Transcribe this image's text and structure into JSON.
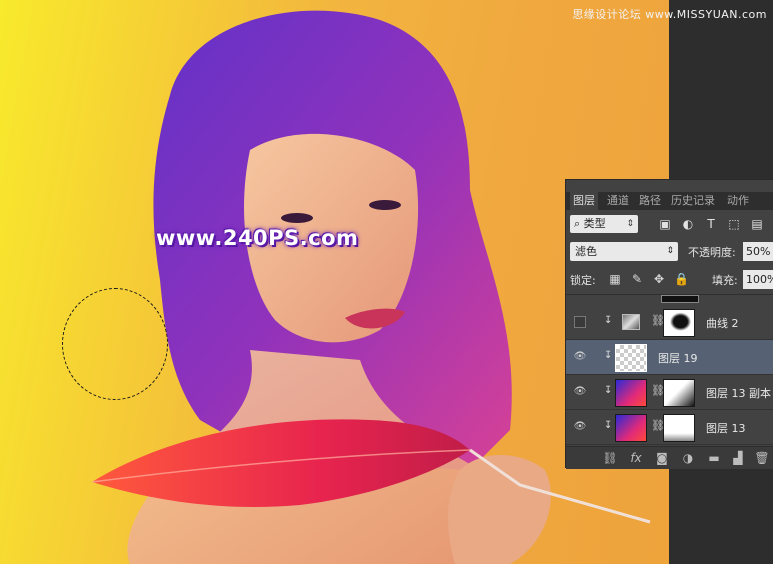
{
  "canvas": {
    "watermark_top": "思缘设计论坛 www.MISSYUAN.com",
    "watermark_main": "www.240PS.com"
  },
  "layers_panel": {
    "tabs": [
      {
        "label": "图层",
        "active": true
      },
      {
        "label": "通道",
        "active": false
      },
      {
        "label": "路径",
        "active": false
      },
      {
        "label": "历史记录",
        "active": false
      },
      {
        "label": "动作",
        "active": false
      }
    ],
    "filter": {
      "kind_label": "类型",
      "icons": [
        "image-filter-icon",
        "adjustment-filter-icon",
        "text-filter-icon",
        "shape-filter-icon",
        "smart-object-filter-icon"
      ]
    },
    "blend_mode": "滤色",
    "opacity_label": "不透明度:",
    "opacity_value": "50%",
    "lock_label": "锁定:",
    "lock_icons": [
      "lock-transparent-icon",
      "lock-image-icon",
      "lock-position-icon",
      "lock-all-icon"
    ],
    "fill_label": "填充:",
    "fill_value": "100%",
    "layers": [
      {
        "name": "曲线 2",
        "visible": false,
        "type": "curves"
      },
      {
        "name": "图层 19",
        "visible": true,
        "selected": true,
        "type": "empty"
      },
      {
        "name": "图层 13 副本",
        "visible": true,
        "type": "gradient"
      },
      {
        "name": "图层 13",
        "visible": true,
        "type": "gradient"
      }
    ],
    "bottom_icons": [
      "link-layers-icon",
      "fx-icon",
      "add-mask-icon",
      "new-adjustment-icon",
      "new-group-icon",
      "new-layer-icon",
      "delete-layer-icon"
    ],
    "bottom_fx_label": "fx"
  },
  "colors": {
    "canvas_left": "#f8ea2c",
    "canvas_right": "#eea33b",
    "panel_bg": "#424242",
    "selected_row": "#566273"
  }
}
